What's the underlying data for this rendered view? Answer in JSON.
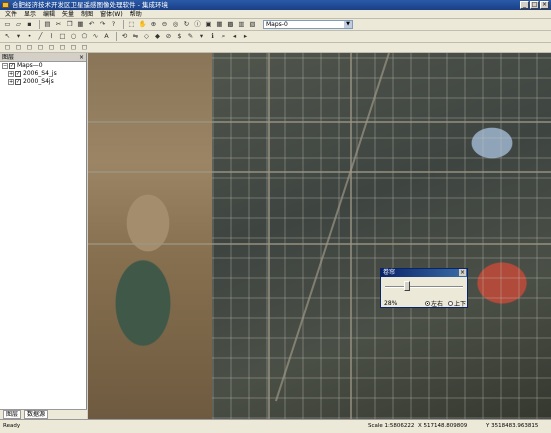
{
  "window": {
    "title": "合肥经济技术开发区卫星遥感图像处理软件 - 集成环境",
    "min": "_",
    "max": "□",
    "close": "×"
  },
  "menu": [
    "文件",
    "显示",
    "编辑",
    "矢量",
    "制图",
    "窗体(W)",
    "帮助"
  ],
  "toolbar": {
    "scale_combo": "Maps-0",
    "combo_arrow": "▼"
  },
  "toc": {
    "title": "图层",
    "root": "Maps—0",
    "layers": [
      "2006_S4_js",
      "2000_S4js"
    ],
    "tabs": [
      "图层",
      "数据源"
    ]
  },
  "swipe_dialog": {
    "title": "卷帘",
    "percent": "28%",
    "percent_value": 0.28,
    "options": [
      "左右",
      "上下"
    ],
    "selected": "左右"
  },
  "status": {
    "left": "Ready",
    "scale": "Scale 1:5806222",
    "x": "X 517148.809809",
    "y": "Y 3518483.963815"
  },
  "colors": {
    "title_bar": "#1a3f86",
    "chrome": "#ece9d8",
    "dialog_title": "#0a246a"
  }
}
